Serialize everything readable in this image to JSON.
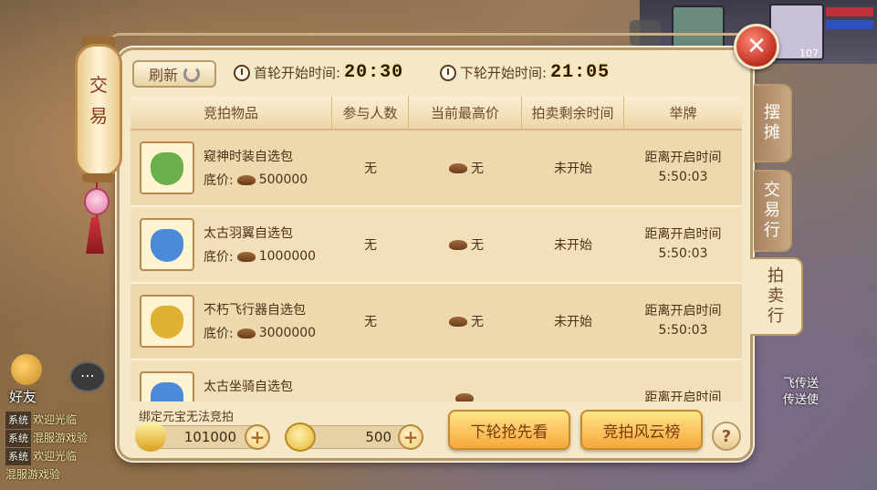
{
  "background": {
    "level": "107",
    "friend_label": "好友",
    "chat_lines": [
      {
        "tag": "系统",
        "text": "欢迎光临"
      },
      {
        "tag": "系统",
        "text": "混服游戏验"
      },
      {
        "tag": "系统",
        "text": "欢迎光临"
      },
      {
        "tag": "",
        "text": "混服游戏验"
      }
    ],
    "right_text_1": "飞传送",
    "right_text_2": "传送使"
  },
  "lantern": {
    "char_1": "交",
    "char_2": "易"
  },
  "toolbar": {
    "refresh_label": "刷新",
    "first_round_label": "首轮开始时间:",
    "first_round_time": "20:30",
    "next_round_label": "下轮开始时间:",
    "next_round_time": "21:05"
  },
  "table": {
    "headers": [
      "竞拍物品",
      "参与人数",
      "当前最高价",
      "拍卖剩余时间",
      "举牌"
    ],
    "price_prefix": "底价:",
    "rows": [
      {
        "name": "窥神时装自选包",
        "price": "500000",
        "participants": "无",
        "highest": "无",
        "remaining": "未开始",
        "bid_line1": "距离开启时间",
        "bid_line2": "5:50:03",
        "bag_color": "#6ab04c"
      },
      {
        "name": "太古羽翼自选包",
        "price": "1000000",
        "participants": "无",
        "highest": "无",
        "remaining": "未开始",
        "bid_line1": "距离开启时间",
        "bid_line2": "5:50:03",
        "bag_color": "#4a8ad8"
      },
      {
        "name": "不朽飞行器自选包",
        "price": "3000000",
        "participants": "无",
        "highest": "无",
        "remaining": "未开始",
        "bid_line1": "距离开启时间",
        "bid_line2": "5:50:03",
        "bag_color": "#e0b030"
      },
      {
        "name": "太古坐骑自选包",
        "price": "",
        "participants": "",
        "highest": "",
        "remaining": "",
        "bid_line1": "距离开启时间",
        "bid_line2": "",
        "bag_color": "#4a8ad8"
      }
    ]
  },
  "tabs": [
    {
      "label": "摆摊",
      "active": false
    },
    {
      "label": "交易行",
      "active": false
    },
    {
      "label": "拍卖行",
      "active": true
    }
  ],
  "footer": {
    "bind_note": "绑定元宝无法竞拍",
    "ingot_amount": "101000",
    "coin_amount": "500",
    "next_round_btn": "下轮抢先看",
    "ranking_btn": "竞拍风云榜",
    "help": "?"
  },
  "close_label": "✕"
}
